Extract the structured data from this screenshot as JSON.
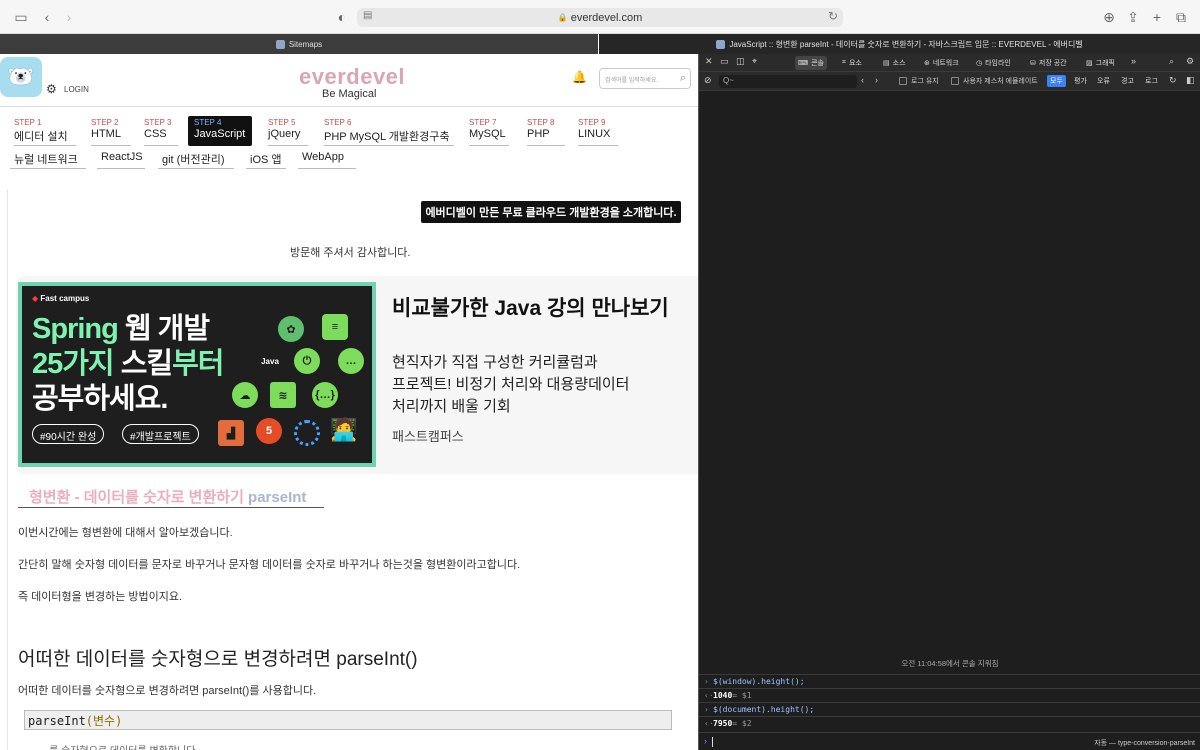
{
  "browser": {
    "url": "everdevel.com",
    "tabs": [
      {
        "title": "Sitemaps"
      },
      {
        "title": "JavaScript :: 형변환 parseInt - 데이터를 숫자로 변환하기 - 자바스크립트 입문 :: EVERDEVEL - 에버디벨"
      }
    ]
  },
  "site": {
    "login": "LOGIN",
    "name": "everdevel",
    "tagline": "Be Magical",
    "search_placeholder": "검색어를 입력하세요."
  },
  "steps": [
    {
      "label": "STEP 1",
      "name": "에디터 설치"
    },
    {
      "label": "STEP 2",
      "name": "HTML"
    },
    {
      "label": "STEP 3",
      "name": "CSS"
    },
    {
      "label": "STEP 4",
      "name": "JavaScript"
    },
    {
      "label": "STEP 5",
      "name": "jQuery"
    },
    {
      "label": "STEP 6",
      "name": "PHP MySQL 개발환경구축"
    },
    {
      "label": "STEP 7",
      "name": "MySQL"
    },
    {
      "label": "STEP 8",
      "name": "PHP"
    },
    {
      "label": "STEP 9",
      "name": "LINUX"
    }
  ],
  "extra_nav": [
    "뉴럴 네트워크",
    "ReactJS",
    "git (버전관리)",
    "iOS 앱",
    "WebApp"
  ],
  "promo": "에버디벨이 만든 무료 클라우드 개발환경을 소개합니다.",
  "thanks": "방문해 주셔서 감사합니다.",
  "ad": {
    "brand": "Fast campus",
    "headline_1a": "Spring",
    "headline_1b": " 웹 개발",
    "headline_2a": "25가지 ",
    "headline_2b": "스킬",
    "headline_2c": "부터",
    "headline_3": "공부하세요.",
    "tag1": "#90시간 완성",
    "tag2": "#개발프로젝트",
    "java": "Java",
    "num5": "5",
    "title": "비교불가한 Java 강의 만나보기",
    "line1": "현직자가 직접 구성한 커리큘럼과",
    "line2": "프로젝트! 비정기 처리와 대용량데이터",
    "line3": "처리까지 배울 기회",
    "source": "패스트캠퍼스"
  },
  "article": {
    "title_a": "형변환 - 데이터를 숫자로 변환하기",
    "title_b": " parseInt",
    "p1": "이번시간에는 형변환에 대해서 알아보겠습니다.",
    "p2": "간단히 말해 숫자형 데이터를 문자로 바꾸거나 문자형 데이터를 숫자로 바꾸거나 하는것을 형변환이라고합니다.",
    "p3": "즉 데이터형을 변경하는 방법이지요.",
    "h2": "어떠한 데이터를 숫자형으로 변경하려면 parseInt()",
    "p4": "어떠한 데이터를 숫자형으로 변경하려면 parseInt()를 사용합니다.",
    "code_fn": "parseInt",
    "code_arg": "(변수)",
    "cut": "... 를 숫자형으로 데이터를 변환합니다."
  },
  "devtools": {
    "tabs": [
      "콘솔",
      "요소",
      "소스",
      "네트워크",
      "타임라인",
      "저장 공간",
      "그래픽"
    ],
    "filter_placeholder": "Q~",
    "opt_preserve": "로그 유지",
    "opt_emulation": "사용자 제스처 에뮬레이트",
    "levels": [
      "모두",
      "평가",
      "오류",
      "경고",
      "로그"
    ],
    "cleared": "오전 11:04:58에서 콘솔 지워짐",
    "lines": [
      {
        "type": "cmd",
        "text": "$(window).height();"
      },
      {
        "type": "res",
        "value": "1040",
        "suffix": " = $1"
      },
      {
        "type": "cmd",
        "text": "$(document).height();"
      },
      {
        "type": "res",
        "value": "7950",
        "suffix": " = $2"
      }
    ],
    "context": "자동 — type-conversion-parseInt"
  },
  "colors": {
    "brand_pink": "#d9a6b3",
    "step_red": "#c0504d",
    "accent_green": "#6fd2b3",
    "devtools_bg": "#1e1e1e",
    "filter_selected": "#3b82f6"
  }
}
